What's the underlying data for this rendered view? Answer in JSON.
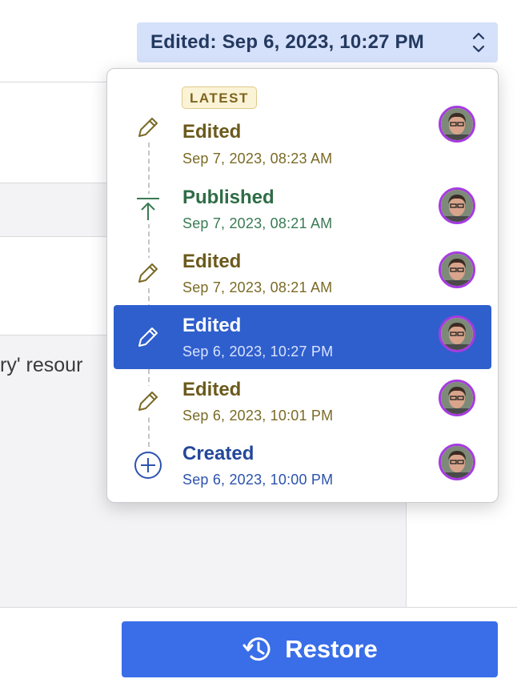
{
  "version_selector": {
    "label": "Edited: Sep 6, 2023, 10:27 PM",
    "icon": "chevron-up-down-icon"
  },
  "background": {
    "truncated_text": "ry' resour"
  },
  "history": {
    "latest_badge": "LATEST",
    "items": [
      {
        "action": "Edited",
        "timestamp": "Sep 7, 2023, 08:23 AM",
        "icon": "pencil-icon",
        "color": "#6b5a1c",
        "latest": true,
        "selected": false
      },
      {
        "action": "Published",
        "timestamp": "Sep 7, 2023, 08:21 AM",
        "icon": "publish-icon",
        "color": "#2e6d46",
        "latest": false,
        "selected": false
      },
      {
        "action": "Edited",
        "timestamp": "Sep 7, 2023, 08:21 AM",
        "icon": "pencil-icon",
        "color": "#6b5a1c",
        "latest": false,
        "selected": false
      },
      {
        "action": "Edited",
        "timestamp": "Sep 6, 2023, 10:27 PM",
        "icon": "pencil-icon",
        "color": "#ffffff",
        "latest": false,
        "selected": true
      },
      {
        "action": "Edited",
        "timestamp": "Sep 6, 2023, 10:01 PM",
        "icon": "pencil-icon",
        "color": "#6b5a1c",
        "latest": false,
        "selected": false
      },
      {
        "action": "Created",
        "timestamp": "Sep 6, 2023, 10:00 PM",
        "icon": "plus-circle-icon",
        "color": "#23479a",
        "latest": false,
        "selected": false
      }
    ]
  },
  "restore_button": {
    "label": "Restore",
    "icon": "history-icon",
    "color": "#3a6ee8"
  },
  "colors": {
    "selected_row": "#2f5fcd",
    "avatar_ring": "#a63be0",
    "selector_bg": "#d5e0fa"
  }
}
